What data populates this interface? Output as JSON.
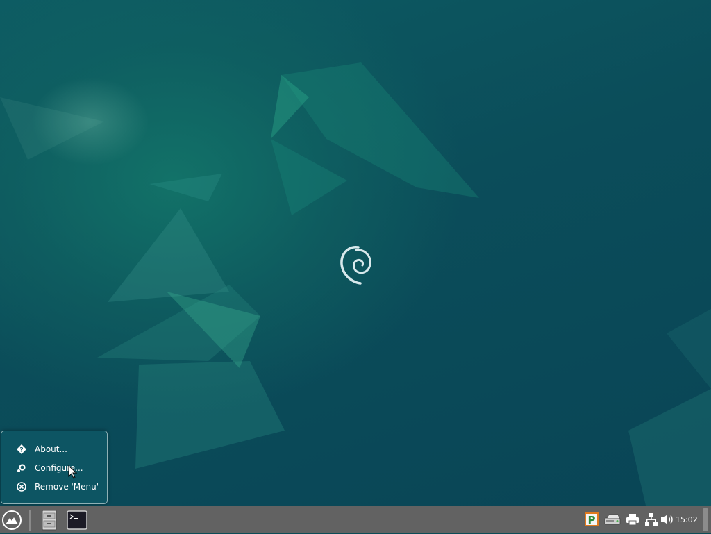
{
  "desktop": {
    "wallpaper": "debian-homeworld",
    "accent_color": "#0c4c57",
    "logo_icon": "debian-swirl-icon"
  },
  "context_menu": {
    "items": [
      {
        "icon": "help-icon",
        "label": "About..."
      },
      {
        "icon": "gear-icon",
        "label": "Configure..."
      },
      {
        "icon": "remove-icon",
        "label": "Remove 'Menu'"
      }
    ]
  },
  "taskbar": {
    "start_icon": "whisker-menu-icon",
    "launchers": [
      {
        "icon": "file-manager-icon"
      },
      {
        "icon": "terminal-icon"
      }
    ],
    "tray": [
      {
        "icon": "package-updates-icon"
      },
      {
        "icon": "removable-drive-icon"
      },
      {
        "icon": "printer-icon"
      },
      {
        "icon": "network-icon"
      },
      {
        "icon": "volume-icon"
      }
    ],
    "clock": "15:02"
  }
}
